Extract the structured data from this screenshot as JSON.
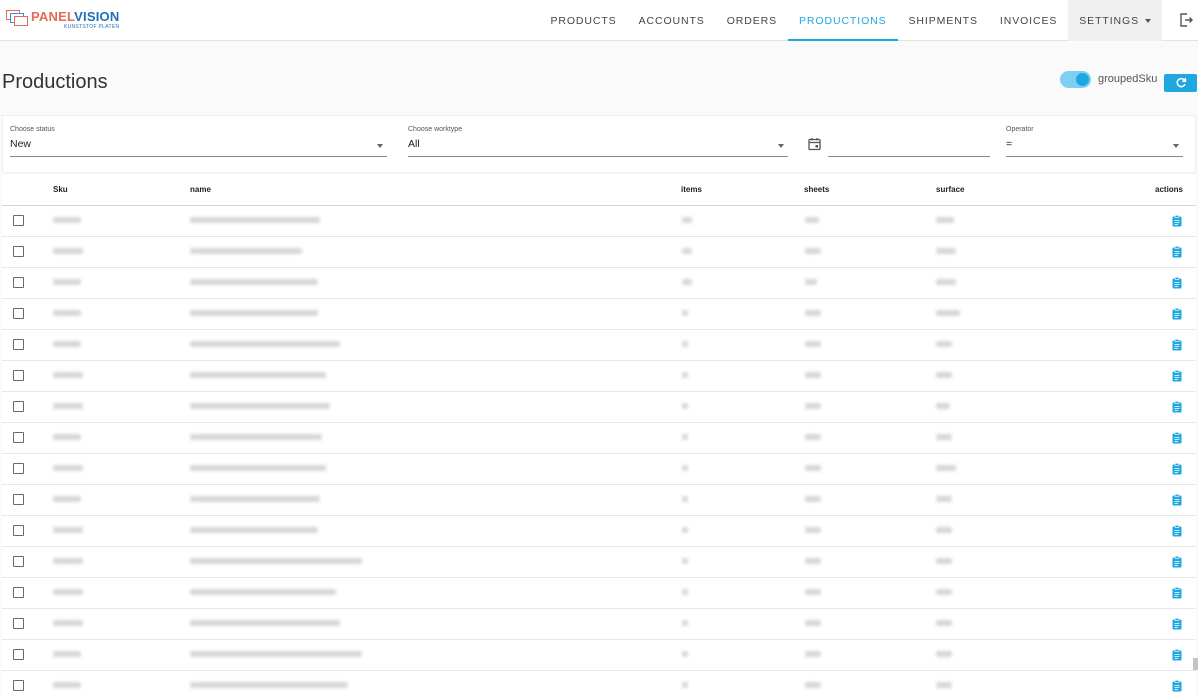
{
  "brand": {
    "name_part1": "PANEL",
    "name_part2": "VISION",
    "tagline": "KUNSTSTOF PLATEN",
    "colors": {
      "accent": "#1ea7e1",
      "logo_red": "#e46a55",
      "logo_blue": "#1f6fb5"
    }
  },
  "nav": {
    "items": [
      {
        "label": "PRODUCTS"
      },
      {
        "label": "ACCOUNTS"
      },
      {
        "label": "ORDERS"
      },
      {
        "label": "PRODUCTIONS",
        "active": true
      },
      {
        "label": "SHIPMENTS"
      },
      {
        "label": "INVOICES"
      },
      {
        "label": "SETTINGS",
        "has_dropdown": true
      }
    ],
    "logout_icon": "logout-icon"
  },
  "page": {
    "title": "Productions",
    "toggle": {
      "label": "groupedSku",
      "on": true
    },
    "refresh_icon": "refresh-icon"
  },
  "filters": {
    "status": {
      "label": "Choose status",
      "value": "New"
    },
    "worktype": {
      "label": "Choose worktype",
      "value": "All"
    },
    "date": {
      "value": "",
      "icon": "calendar-icon"
    },
    "operator": {
      "label": "Operator",
      "value": "="
    }
  },
  "table": {
    "columns": [
      "Sku",
      "name",
      "items",
      "sheets",
      "surface",
      "actions"
    ],
    "row_count": 16,
    "row_action_icon": "clipboard-icon",
    "note": "row cell contents are blurred/redacted in the screenshot"
  }
}
